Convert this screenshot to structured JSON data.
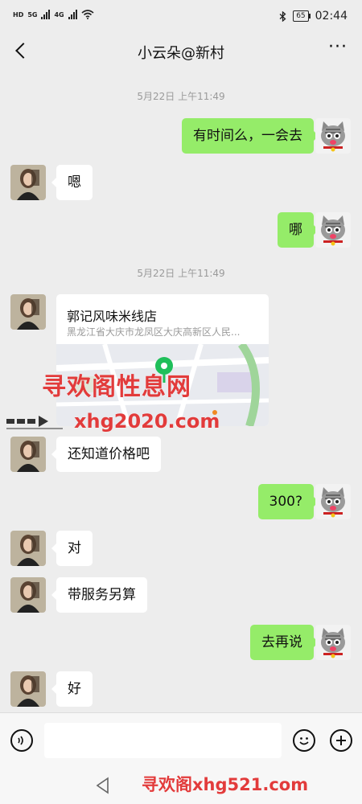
{
  "status_bar": {
    "network_labels": [
      "HD",
      "5G",
      "4G"
    ],
    "battery": "65",
    "time": "02:44"
  },
  "nav": {
    "title": "小云朵@新村",
    "more": "···"
  },
  "messages": {
    "time_1": "5月22日 上午11:49",
    "out_1": "有时间么，一会去",
    "in_1": "嗯",
    "out_2": "哪",
    "time_2": "5月22日 上午11:49",
    "location": {
      "name": "郭记风味米线店",
      "address": "黑龙江省大庆市龙凤区大庆高新区人民..."
    },
    "in_2": "还知道价格吧",
    "out_3": "300?",
    "in_3": "对",
    "in_4": "带服务另算",
    "out_4": "去再说",
    "in_5": "好"
  },
  "watermarks": {
    "top": "寻欢阁性息网",
    "mid": "xhg2020.com",
    "bottom": "寻欢阁xhg521.com"
  },
  "icons": {
    "back": "chevron-left-icon",
    "more": "more-dots-icon",
    "voice": "voice-icon",
    "emoji": "emoji-icon",
    "plus": "plus-icon"
  },
  "colors": {
    "outgoing_bubble": "#95ec69",
    "incoming_bubble": "#ffffff",
    "background": "#ededed",
    "map_pin": "#1fbf5a"
  }
}
